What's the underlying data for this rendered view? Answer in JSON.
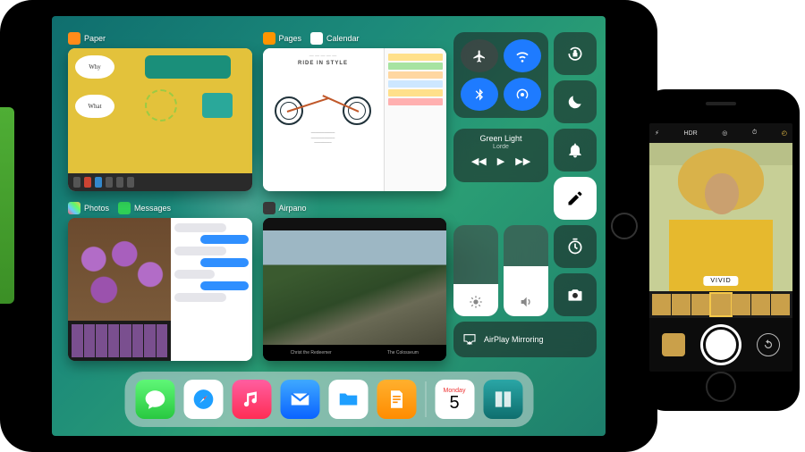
{
  "switcher": {
    "card1": {
      "app": "Paper",
      "bubble_why": "Why",
      "bubble_what": "What"
    },
    "card2": {
      "app1": "Pages",
      "app2": "Calendar",
      "headline": "RIDE IN STYLE"
    },
    "card3": {
      "app1": "Photos",
      "app2": "Messages"
    },
    "card4": {
      "app": "Airpano",
      "top": "",
      "cap1": "Christ the Redeemer",
      "cap2": "The Colosseum"
    }
  },
  "cc": {
    "airplane": "airplane-icon",
    "wifi": "wifi-icon",
    "bluetooth": "bluetooth-icon",
    "airdrop": "airdrop-icon",
    "lock": "orientation-lock-icon",
    "dnd": "moon-icon",
    "music_title": "Green Light",
    "music_artist": "Lorde",
    "bell": "bell-icon",
    "note": "note-icon",
    "timer": "timer-icon",
    "camera": "camera-icon",
    "brightness_pct": 35,
    "volume_pct": 55,
    "airplay_label": "AirPlay Mirroring"
  },
  "dock": {
    "messages": "Messages",
    "safari": "Safari",
    "music": "Music",
    "mail": "Mail",
    "files": "Files",
    "pages": "Pages",
    "calendar_dow": "Monday",
    "calendar_day": "5",
    "travel": "Travel Book"
  },
  "camera": {
    "flash": "⚡︎",
    "hdr": "HDR",
    "live": "live-icon",
    "timer": "timer-icon",
    "filter": "filter-icon",
    "filter_label": "VIVID"
  }
}
